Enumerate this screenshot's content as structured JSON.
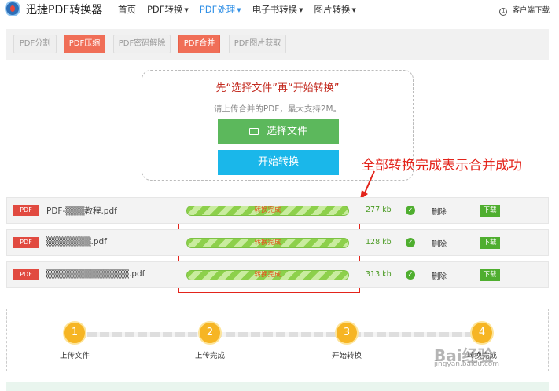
{
  "header": {
    "brand": "迅捷PDF转换器",
    "nav": [
      {
        "label": "首页",
        "caret": ""
      },
      {
        "label": "PDF转换",
        "caret": "▼"
      },
      {
        "label": "PDF处理",
        "caret": "▼"
      },
      {
        "label": "电子书转换",
        "caret": "▼"
      },
      {
        "label": "图片转换",
        "caret": "▼"
      }
    ],
    "active_nav": "PDF处理",
    "client_download": "客户端下载",
    "client_download_icon": "download-icon"
  },
  "tools": [
    {
      "label": "PDF分割",
      "active": false
    },
    {
      "label": "PDF压缩",
      "active": true
    },
    {
      "label": "PDF密码解除",
      "active": false
    },
    {
      "label": "PDF合并",
      "active": true
    },
    {
      "label": "PDF图片获取",
      "active": false
    }
  ],
  "upload": {
    "title": "先“选择文件”再“开始转换”",
    "hint": "请上传合并的PDF，最大支持2M。",
    "select_label": "选择文件",
    "start_label": "开始转换"
  },
  "annotation": {
    "text": "全部转换完成表示合并成功",
    "color": "#e3241b"
  },
  "files": [
    {
      "badge": "PDF",
      "name": "PDF-▒▒▒教程.pdf",
      "status": "转换完成",
      "progress_percent": 100,
      "size": "277 kb",
      "delete": "删除",
      "download": "下载"
    },
    {
      "badge": "PDF",
      "name": "▒▒▒▒▒▒▒.pdf",
      "status": "转换完成",
      "progress_percent": 100,
      "size": "128 kb",
      "delete": "删除",
      "download": "下载"
    },
    {
      "badge": "PDF",
      "name": "▒▒▒▒▒▒▒▒▒▒▒▒▒.pdf",
      "status": "转换完成",
      "progress_percent": 100,
      "size": "313 kb",
      "delete": "删除",
      "download": "下载"
    }
  ],
  "steps": [
    {
      "num": "1",
      "label": "上传文件"
    },
    {
      "num": "2",
      "label": "上传完成"
    },
    {
      "num": "3",
      "label": "开始转换"
    },
    {
      "num": "4",
      "label": "转换完成"
    }
  ],
  "watermark": {
    "text": "Bai经验",
    "sub": "jingyan.baidu.com"
  },
  "colors": {
    "accent": "#2f8fe6",
    "tool_active": "#f06e57",
    "select_button": "#5cb85c",
    "start_button": "#1ab7ea",
    "pdf_badge": "#e14a40",
    "progress": "#8dd04b",
    "step": "#f6b524"
  }
}
